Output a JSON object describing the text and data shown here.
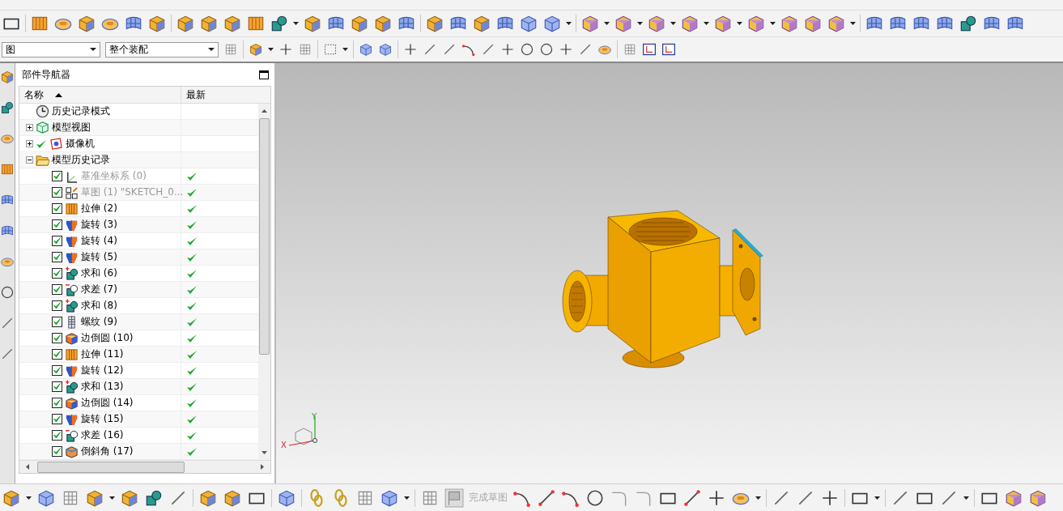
{
  "toolbar": {
    "filter_dropdowns": [
      {
        "value": "图"
      },
      {
        "value": "整个装配"
      }
    ]
  },
  "navigator": {
    "title": "部件导航器",
    "columns": [
      {
        "label": "名称",
        "sort_ascending": true
      },
      {
        "label": "最新"
      }
    ],
    "tree": [
      {
        "label": "历史记录模式",
        "kind": "history_mode"
      },
      {
        "label": "模型视图",
        "kind": "model_views",
        "expanded": false
      },
      {
        "label": "摄像机",
        "kind": "cameras",
        "expanded": false,
        "checked": true
      },
      {
        "label": "模型历史记录",
        "kind": "folder",
        "expanded": true,
        "children": [
          {
            "label": "基准坐标系 (0)",
            "kind": "datum",
            "checked": true,
            "disabled": true,
            "latest": true
          },
          {
            "label": "草图 (1) \"SKETCH_0...",
            "kind": "sketch",
            "checked": true,
            "disabled": true,
            "latest": true
          },
          {
            "label": "拉伸 (2)",
            "kind": "extrude",
            "checked": true,
            "disabled": false,
            "latest": true
          },
          {
            "label": "旋转 (3)",
            "kind": "revolve",
            "checked": true,
            "disabled": false,
            "latest": true
          },
          {
            "label": "旋转 (4)",
            "kind": "revolve",
            "checked": true,
            "disabled": false,
            "latest": true
          },
          {
            "label": "旋转 (5)",
            "kind": "revolve",
            "checked": true,
            "disabled": false,
            "latest": true
          },
          {
            "label": "求和 (6)",
            "kind": "unite",
            "checked": true,
            "disabled": false,
            "latest": true
          },
          {
            "label": "求差 (7)",
            "kind": "subtract",
            "checked": true,
            "disabled": false,
            "latest": true
          },
          {
            "label": "求和 (8)",
            "kind": "unite",
            "checked": true,
            "disabled": false,
            "latest": true
          },
          {
            "label": "螺纹 (9)",
            "kind": "thread",
            "checked": true,
            "disabled": false,
            "latest": true
          },
          {
            "label": "边倒圆 (10)",
            "kind": "blend",
            "checked": true,
            "disabled": false,
            "latest": true
          },
          {
            "label": "拉伸 (11)",
            "kind": "extrude",
            "checked": true,
            "disabled": false,
            "latest": true
          },
          {
            "label": "旋转 (12)",
            "kind": "revolve",
            "checked": true,
            "disabled": false,
            "latest": true
          },
          {
            "label": "求和 (13)",
            "kind": "unite",
            "checked": true,
            "disabled": false,
            "latest": true
          },
          {
            "label": "边倒圆 (14)",
            "kind": "blend",
            "checked": true,
            "disabled": false,
            "latest": true
          },
          {
            "label": "旋转 (15)",
            "kind": "revolve",
            "checked": true,
            "disabled": false,
            "latest": true
          },
          {
            "label": "求差 (16)",
            "kind": "subtract",
            "checked": true,
            "disabled": false,
            "latest": true
          },
          {
            "label": "倒斜角 (17)",
            "kind": "chamfer",
            "checked": true,
            "disabled": false,
            "latest": true
          }
        ]
      }
    ]
  },
  "viewport": {
    "triad_labels": [
      "X",
      "Y"
    ]
  },
  "sketch_toolbar": {
    "finish_label": "完成草图",
    "finish_disabled": true
  }
}
